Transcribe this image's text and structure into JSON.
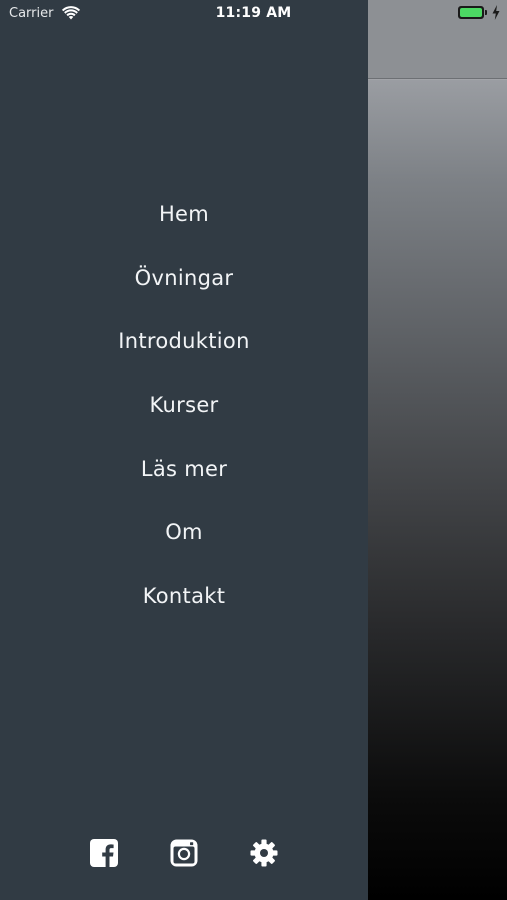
{
  "status_bar": {
    "carrier": "Carrier",
    "time": "11:19 AM",
    "battery_level": 1.0,
    "battery_color": "#4cd964"
  },
  "drawer": {
    "background": "#313b44",
    "menu": [
      {
        "label": "Hem"
      },
      {
        "label": "Övningar"
      },
      {
        "label": "Introduktion"
      },
      {
        "label": "Kurser"
      },
      {
        "label": "Läs mer"
      },
      {
        "label": "Om"
      },
      {
        "label": "Kontakt"
      }
    ],
    "footer_icons": [
      "facebook-icon",
      "instagram-icon",
      "gear-icon"
    ]
  }
}
